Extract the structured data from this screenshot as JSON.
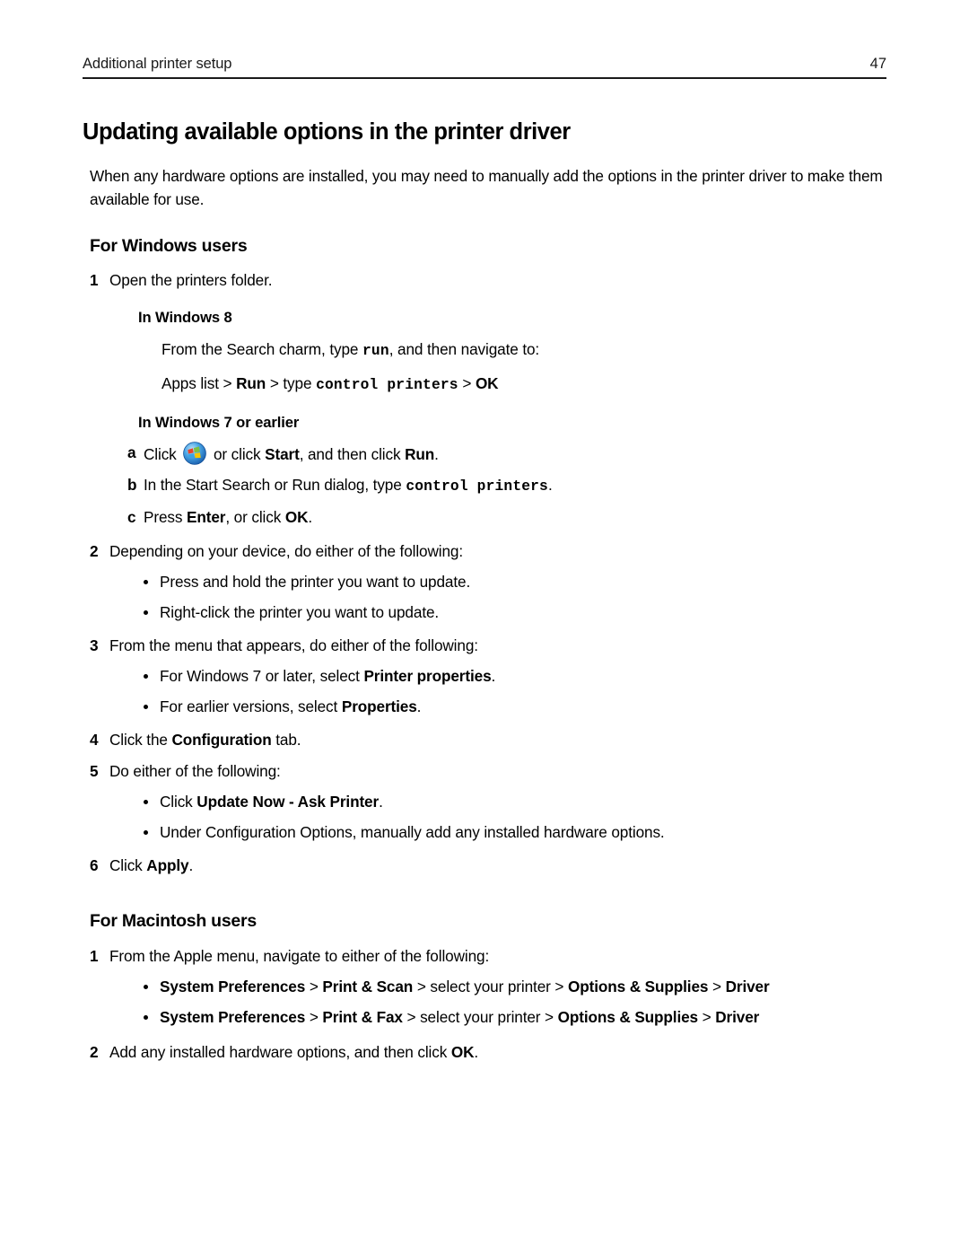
{
  "header": {
    "title": "Additional printer setup",
    "page_number": "47"
  },
  "doc": {
    "title": "Updating available options in the printer driver",
    "intro": "When any hardware options are installed, you may need to manually add the options in the printer driver to make them available for use."
  },
  "windows_section": {
    "heading": "For Windows users",
    "step1": {
      "num": "1",
      "text": "Open the printers folder.",
      "win8_head": "In Windows 8",
      "win8_line1_a": "From the Search charm, type ",
      "win8_line1_code": "run",
      "win8_line1_b": ", and then navigate to:",
      "win8_line2_a": "Apps list > ",
      "win8_line2_run": "Run",
      "win8_line2_b": " > type ",
      "win8_line2_code": "control printers",
      "win8_line2_c": " > ",
      "win8_line2_ok": "OK",
      "win7_head": "In Windows 7 or earlier",
      "a": {
        "marker": "a",
        "t1": "Click ",
        "icon": "windows-orb-icon",
        "t2": " or click ",
        "start": "Start",
        "t3": ", and then click ",
        "run": "Run",
        "t4": "."
      },
      "b": {
        "marker": "b",
        "t1": "In the Start Search or Run dialog, type ",
        "code": "control printers",
        "t2": "."
      },
      "c": {
        "marker": "c",
        "t1": "Press ",
        "enter": "Enter",
        "t2": ", or click ",
        "ok": "OK",
        "t3": "."
      }
    },
    "step2": {
      "num": "2",
      "text": "Depending on your device, do either of the following:",
      "bullets": [
        "Press and hold the printer you want to update.",
        "Right-click the printer you want to update."
      ]
    },
    "step3": {
      "num": "3",
      "text": "From the menu that appears, do either of the following:",
      "bullet1_a": "For Windows 7 or later, select ",
      "bullet1_b": "Printer properties",
      "bullet1_c": ".",
      "bullet2_a": "For earlier versions, select ",
      "bullet2_b": "Properties",
      "bullet2_c": "."
    },
    "step4": {
      "num": "4",
      "t1": "Click the ",
      "bold": "Configuration",
      "t2": " tab."
    },
    "step5": {
      "num": "5",
      "text": "Do either of the following:",
      "bullet1_a": "Click ",
      "bullet1_b": "Update Now ‑ Ask Printer",
      "bullet1_c": ".",
      "bullet2": "Under Configuration Options, manually add any installed hardware options."
    },
    "step6": {
      "num": "6",
      "t1": "Click ",
      "bold": "Apply",
      "t2": "."
    }
  },
  "macintosh_section": {
    "heading": "For Macintosh users",
    "step1": {
      "num": "1",
      "text": "From the Apple menu, navigate to either of the following:",
      "bullet1": {
        "sys_pref": "System Preferences",
        "sep1": " > ",
        "print": "Print & Scan",
        "sep2": " > ",
        "select": "select your printer",
        "sep3": " > ",
        "options": "Options & Supplies",
        "sep4": " > ",
        "driver": "Driver"
      },
      "bullet2": {
        "sys_pref": "System Preferences",
        "sep1": " > ",
        "print": "Print & Fax",
        "sep2": " > ",
        "select": "select your printer",
        "sep3": " > ",
        "options": "Options & Supplies",
        "sep4": " > ",
        "driver": "Driver"
      }
    },
    "step2": {
      "num": "2",
      "t1": "Add any installed hardware options, and then click ",
      "bold": "OK",
      "t2": "."
    }
  },
  "colors": {
    "text": "#000000",
    "rule": "#1a1a1a",
    "orb_blue": "#2f86d8",
    "orb_red": "#e8432c",
    "orb_green": "#7bc043",
    "orb_yellow": "#f6c700",
    "orb_lightblue": "#3aa3e3"
  }
}
